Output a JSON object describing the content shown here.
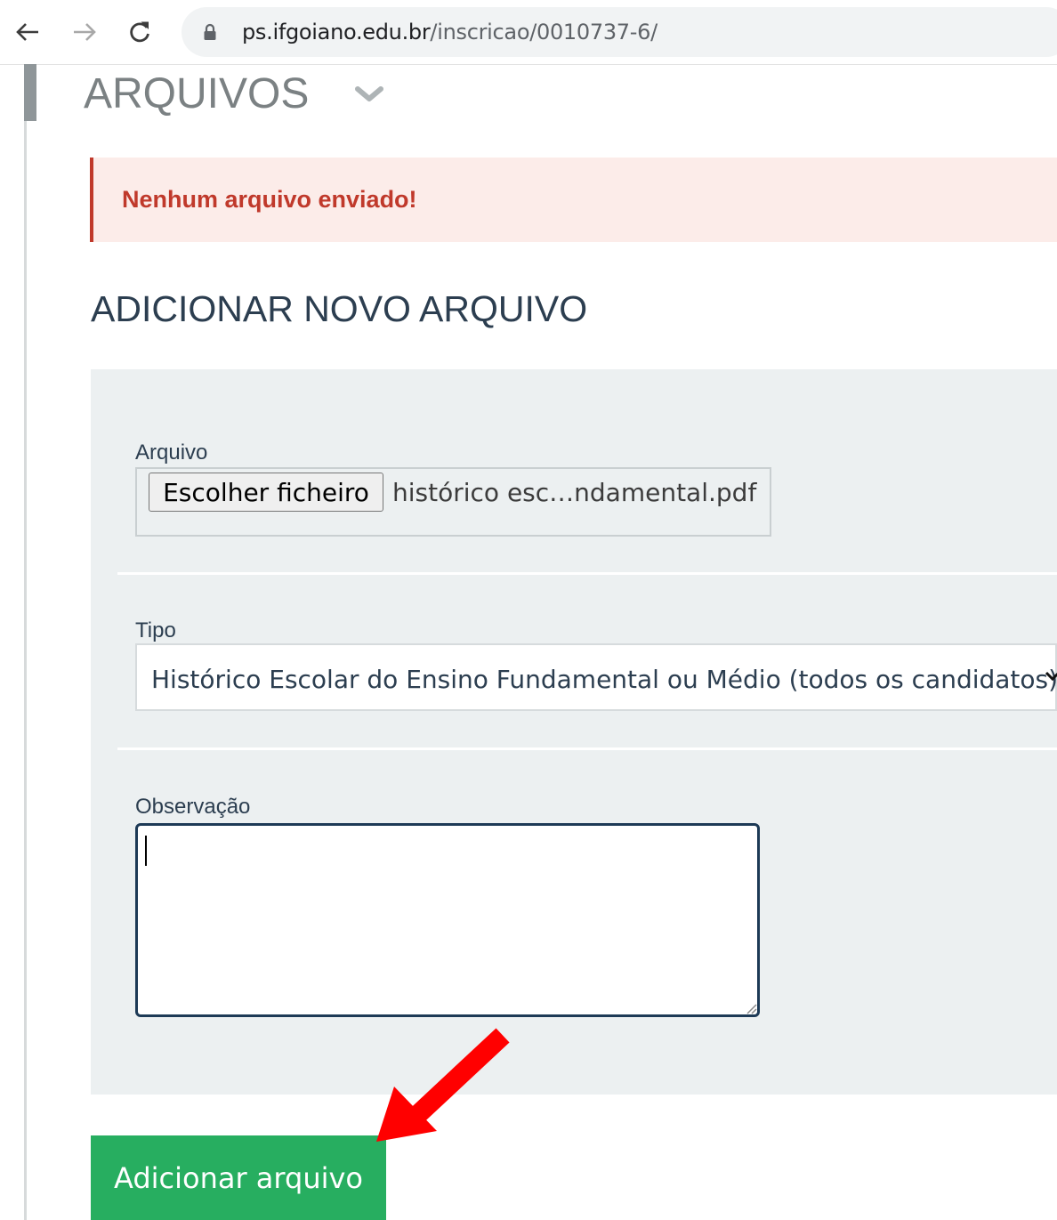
{
  "browser": {
    "url_host": "ps.ifgoiano.edu.br",
    "url_path": "/inscricao/0010737-6/",
    "icons": [
      "back-arrow-icon",
      "forward-arrow-icon",
      "reload-icon",
      "lock-icon"
    ]
  },
  "section": {
    "title": "ARQUIVOS",
    "toggle_icon": "chevron-down-icon"
  },
  "alert": {
    "message": "Nenhum arquivo enviado!",
    "color": "#c0392b",
    "background": "#fcece9"
  },
  "add_form": {
    "title": "ADICIONAR NOVO ARQUIVO",
    "file_label": "Arquivo",
    "file_button_label": "Escolher ficheiro",
    "file_name": "histórico esc…ndamental.pdf",
    "type_label": "Tipo",
    "type_selected": "Histórico Escolar do Ensino Fundamental ou Médio (todos os candidatos)",
    "note_label": "Observação",
    "note_value": "",
    "submit_label": "Adicionar arquivo",
    "submit_color": "#27ae60"
  },
  "annotation": {
    "arrow_color": "#ff0000",
    "arrow_icon": "red-arrow-icon"
  }
}
